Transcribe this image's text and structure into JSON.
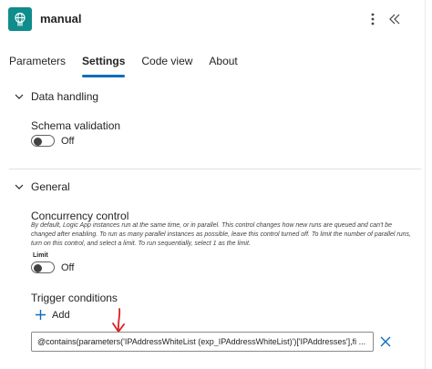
{
  "header": {
    "title": "manual",
    "icon": "globe-touch-icon",
    "more_icon": "more-vertical-icon",
    "collapse_icon": "double-chevron-left-icon",
    "accent_color": "#0f8c8c"
  },
  "tabs": [
    {
      "label": "Parameters",
      "active": false
    },
    {
      "label": "Settings",
      "active": true
    },
    {
      "label": "Code view",
      "active": false
    },
    {
      "label": "About",
      "active": false
    }
  ],
  "sections": {
    "data_handling": {
      "title": "Data handling",
      "expanded": true,
      "schema_validation": {
        "label": "Schema validation",
        "state": "Off"
      }
    },
    "general": {
      "title": "General",
      "expanded": true,
      "concurrency": {
        "label": "Concurrency control",
        "description": "By default, Logic App instances run at the same time, or in parallel. This control changes how new runs are queued and can't be changed after enabling. To run as many parallel instances as possible, leave this control turned off. To limit the number of parallel runs, turn on this control, and select a limit. To run sequentially, select 1 as the limit.",
        "limit_label": "Limit",
        "state": "Off"
      },
      "trigger_conditions": {
        "label": "Trigger conditions",
        "add_label": "Add",
        "conditions": [
          "@contains(parameters('IPAddressWhiteList (exp_IPAddressWhiteList)')['IPAddresses'],fi ..."
        ]
      }
    }
  },
  "colors": {
    "tab_underline": "#0f6cbd",
    "add_icon": "#0f6cbd",
    "delete_icon": "#0f6cbd",
    "annotation_arrow": "#d92020"
  }
}
